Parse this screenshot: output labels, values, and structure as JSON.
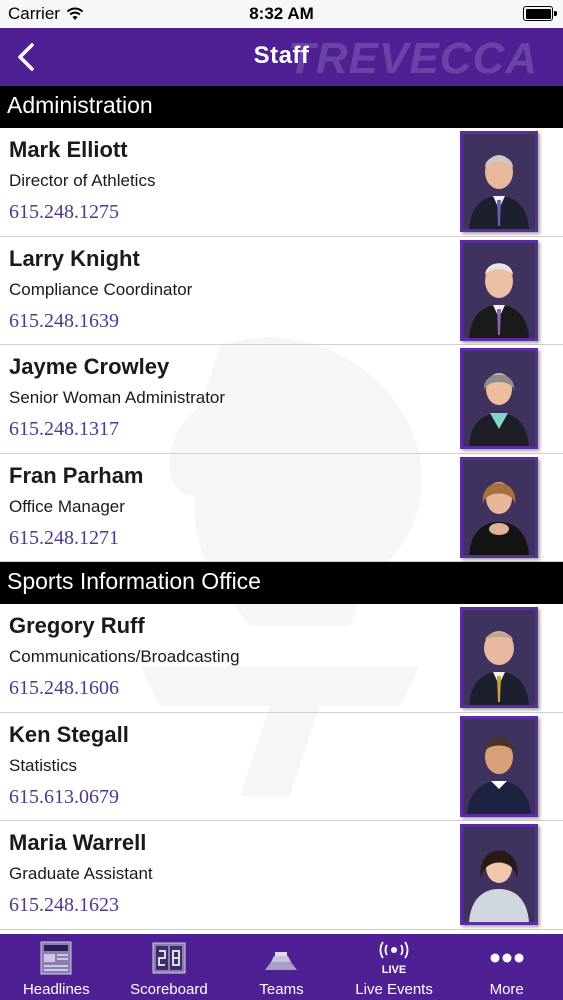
{
  "status_bar": {
    "carrier": "Carrier",
    "time": "8:32 AM"
  },
  "nav": {
    "title": "Staff",
    "watermark": "TREVECCA"
  },
  "sections": [
    {
      "title": "Administration",
      "staff": [
        {
          "name": "Mark Elliott",
          "role": "Director of Athletics",
          "phone": "615.248.1275"
        },
        {
          "name": "Larry Knight",
          "role": "Compliance Coordinator",
          "phone": "615.248.1639"
        },
        {
          "name": "Jayme Crowley",
          "role": "Senior Woman Administrator",
          "phone": "615.248.1317"
        },
        {
          "name": "Fran Parham",
          "role": "Office Manager",
          "phone": "615.248.1271"
        }
      ]
    },
    {
      "title": "Sports Information Office",
      "staff": [
        {
          "name": "Gregory Ruff",
          "role": "Communications/Broadcasting",
          "phone": "615.248.1606"
        },
        {
          "name": "Ken Stegall",
          "role": "Statistics",
          "phone": "615.613.0679"
        },
        {
          "name": "Maria Warrell",
          "role": "Graduate Assistant",
          "phone": "615.248.1623"
        }
      ]
    }
  ],
  "tabs": [
    {
      "label": "Headlines",
      "icon": "newspaper-icon"
    },
    {
      "label": "Scoreboard",
      "icon": "scoreboard-icon"
    },
    {
      "label": "Teams",
      "icon": "teams-icon"
    },
    {
      "label": "Live Events",
      "icon": "live-broadcast-icon"
    },
    {
      "label": "More",
      "icon": "more-dots-icon"
    }
  ],
  "colors": {
    "brand_purple": "#4f1f94",
    "phone_text": "#4d3a8f",
    "section_header": "#000000"
  }
}
